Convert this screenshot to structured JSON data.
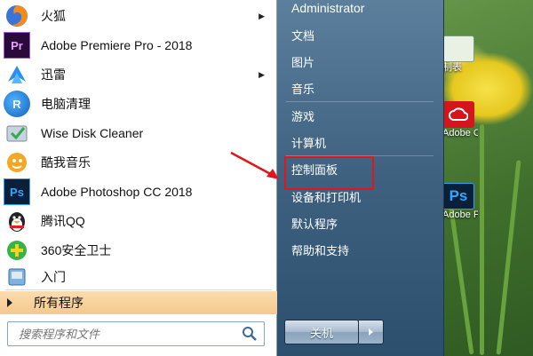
{
  "programs": [
    {
      "name": "火狐",
      "icon": "firefox-icon",
      "has_submenu": true
    },
    {
      "name": "Adobe Premiere Pro - 2018",
      "icon": "premiere-pro-icon",
      "icon_text": "Pr",
      "has_submenu": false
    },
    {
      "name": "迅雷",
      "icon": "xunlei-icon",
      "has_submenu": true
    },
    {
      "name": "电脑清理",
      "icon": "computer-cleanup-icon",
      "icon_text": "R",
      "has_submenu": false
    },
    {
      "name": "Wise Disk Cleaner",
      "icon": "wise-disk-cleaner-icon",
      "has_submenu": false
    },
    {
      "name": "酷我音乐",
      "icon": "kuwo-music-icon",
      "has_submenu": false
    },
    {
      "name": "Adobe Photoshop CC 2018",
      "icon": "photoshop-icon",
      "icon_text": "Ps",
      "has_submenu": false
    },
    {
      "name": "腾讯QQ",
      "icon": "qq-penguin-icon",
      "has_submenu": false
    },
    {
      "name": "360安全卫士",
      "icon": "360-security-icon",
      "has_submenu": false
    },
    {
      "name": "入门",
      "icon": "getting-started-icon",
      "has_submenu": false
    }
  ],
  "all_programs": "所有程序",
  "search": {
    "placeholder": "搜索程序和文件"
  },
  "right_items": [
    {
      "label": "Administrator"
    },
    {
      "label": "文档"
    },
    {
      "label": "图片"
    },
    {
      "label": "音乐"
    },
    {
      "label": "游戏"
    },
    {
      "label": "计算机"
    },
    {
      "label": "控制面板",
      "highlighted": true
    },
    {
      "label": "设备和打印机"
    },
    {
      "label": "默认程序"
    },
    {
      "label": "帮助和支持"
    }
  ],
  "shutdown": {
    "label": "关机"
  },
  "desktop_icons": [
    {
      "label": "制表",
      "icon": "spreadsheet-icon"
    },
    {
      "label": "Adobe Creati...",
      "icon": "adobe-creative-cloud-icon"
    },
    {
      "label": "Adobe Photosh...",
      "icon": "photoshop-desktop-icon",
      "icon_text": "Ps"
    }
  ],
  "colors": {
    "highlight_box": "#e3141a",
    "right_panel": "#3e6180",
    "all_programs_bg": "#f4c98e"
  }
}
